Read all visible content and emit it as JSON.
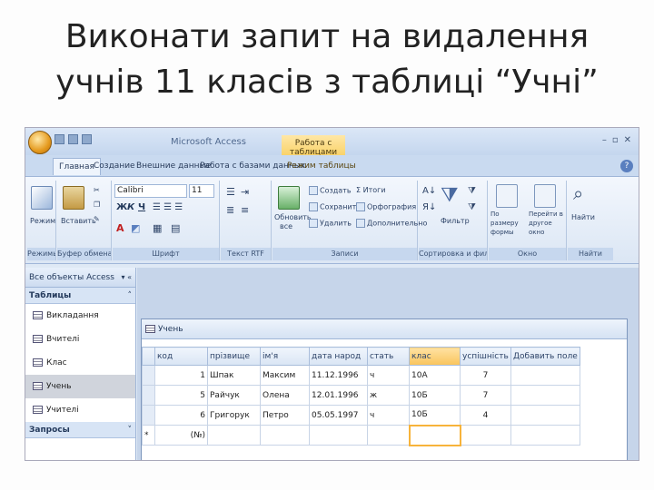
{
  "slide": {
    "title_line1": "Виконати запит на видалення",
    "title_line2": "учнів 11 класів з таблиці “Учні”"
  },
  "app": {
    "window_title": "Microsoft Access",
    "context_title": "Работа с таблицами",
    "tabs": [
      "Главная",
      "Создание",
      "Внешние данные",
      "Работа с базами данных",
      "Режим таблицы"
    ],
    "ribbon": {
      "groups": [
        "Режимы",
        "Буфер обмена",
        "Шрифт",
        "Текст RTF",
        "Записи",
        "Сортировка и фильтр",
        "Окно",
        "Найти"
      ],
      "view_button": "Режим",
      "paste_button": "Вставить",
      "font_name": "Calibri",
      "font_size": "11",
      "format_buttons": [
        "Ж",
        "К",
        "Ч"
      ],
      "refresh_button_line1": "Обновить",
      "refresh_button_line2": "все",
      "records_items": [
        "Создать",
        "Сохранить",
        "Удалить",
        "Итоги",
        "Орфография",
        "Дополнительно"
      ],
      "filter_button": "Фильтр",
      "window_items": [
        "По размеру формы",
        "Перейти в другое окно"
      ],
      "find_button": "Найти"
    },
    "nav": {
      "header": "Все объекты Access",
      "group_tables": "Таблицы",
      "items": [
        "Викладання",
        "Вчителі",
        "Клас",
        "Учень",
        "Учителі"
      ],
      "group_queries": "Запросы"
    },
    "table": {
      "tab_title": "Учень",
      "columns": [
        "код",
        "прізвище",
        "ім'я",
        "дата народ",
        "стать",
        "клас",
        "успішність",
        "Добавить поле"
      ],
      "rows": [
        [
          "1",
          "Шпак",
          "Максим",
          "11.12.1996",
          "ч",
          "10А",
          "7"
        ],
        [
          "5",
          "Райчук",
          "Олена",
          "12.01.1996",
          "ж",
          "10Б",
          "7"
        ],
        [
          "6",
          "Григорук",
          "Петро",
          "05.05.1997",
          "ч",
          "10Б",
          "4"
        ]
      ],
      "new_row_label": "(№)",
      "new_row_marker": "*"
    }
  }
}
